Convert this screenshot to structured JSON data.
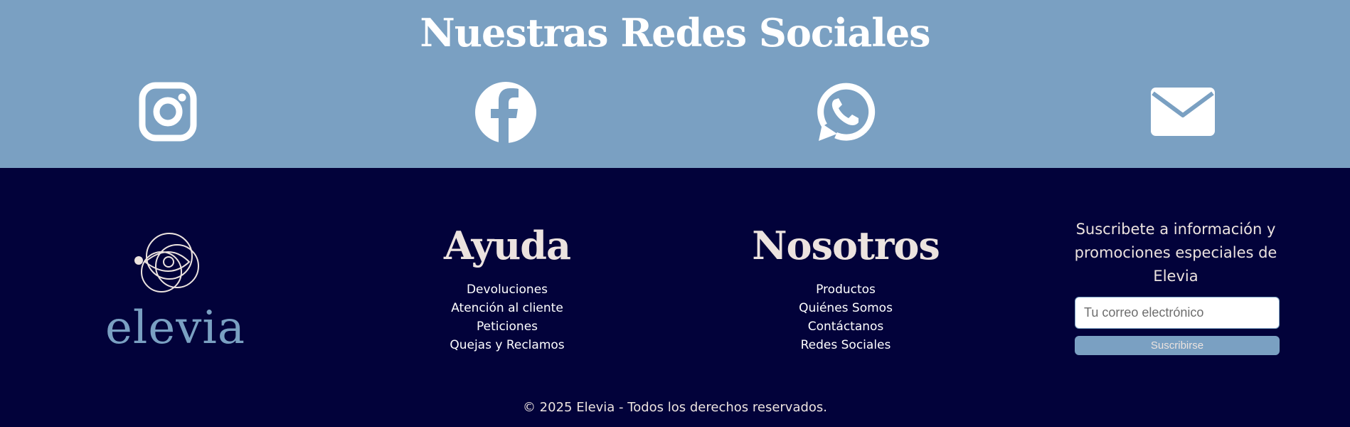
{
  "social": {
    "title": "Nuestras Redes Sociales",
    "icons": [
      "instagram-icon",
      "facebook-icon",
      "whatsapp-icon",
      "email-icon"
    ],
    "background": "#7aa0c2",
    "icon_color": "#ffffff"
  },
  "footer": {
    "background": "#02023a",
    "logo": {
      "wordmark": "elevia",
      "color": "#7aa0c2"
    },
    "help": {
      "title": "Ayuda",
      "links": [
        "Devoluciones",
        "Atención al cliente",
        "Peticiones",
        "Quejas y Reclamos"
      ]
    },
    "about": {
      "title": "Nosotros",
      "links": [
        "Productos",
        "Quiénes Somos",
        "Contáctanos",
        "Redes Sociales"
      ]
    },
    "subscribe": {
      "text": "Suscribete a información y promociones especiales de Elevia",
      "placeholder": "Tu correo electrónico",
      "button": "Suscribirse"
    },
    "copyright": "© 2025 Elevia - Todos los derechos reservados."
  }
}
